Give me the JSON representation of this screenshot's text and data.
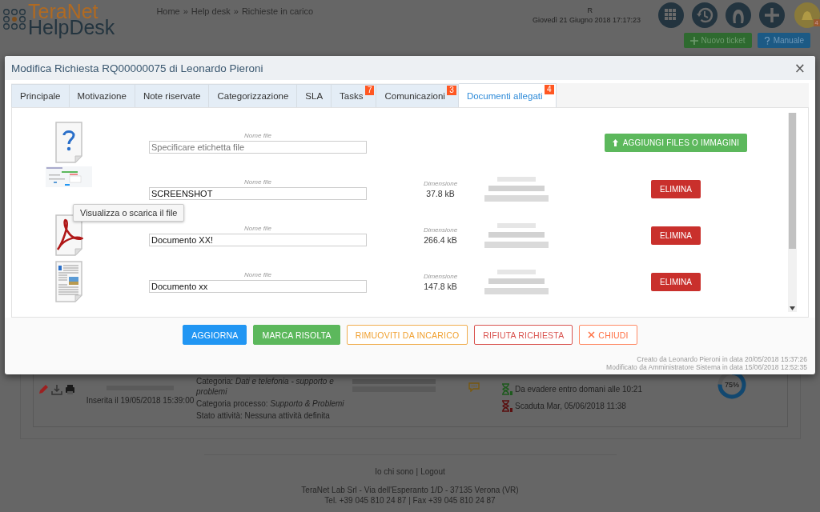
{
  "header": {
    "brand": "TeraNet",
    "product": "HelpDesk",
    "breadcrumb": [
      "Home",
      "Help desk",
      "Richieste in carico"
    ],
    "separator": "»",
    "user_initial": "R",
    "datetime": "Giovedì 21 Giugno 2018 17:17:23",
    "notification_count": "4",
    "buttons": [
      {
        "label": "Nuovo ticket",
        "kind": "new"
      },
      {
        "label": "Manuale",
        "kind": "help"
      }
    ]
  },
  "ticket_card": {
    "inserted": "Inserita il 19/05/2018 15:39:00",
    "details": [
      "Categoria: *Dati e telefonia - supporto e problemi*",
      "Categoria processo: *Supporto & Problemi*",
      "Stato attività:  Nessuna attività definita"
    ],
    "deadlines": [
      {
        "text": "Da evadere entro domani alle 10:21",
        "kind": "ok"
      },
      {
        "text": "Scaduta Mar, 05/06/2018 11:38",
        "kind": "late"
      }
    ],
    "progress": {
      "level": 0.75,
      "label": "75%"
    }
  },
  "footer": {
    "links": [
      "Io chi sono",
      "Logout"
    ],
    "separator": "|",
    "address": [
      "TeraNet Lab Srl - Via dell'Esperanto 1/D - 37135 Verona (VR)",
      "Tel. +39 045 810 24 87 | Fax +39 045 810 24 87"
    ]
  },
  "modal": {
    "title": "Modifica Richiesta RQ00000075 di Leonardo Pieroni",
    "close": "×",
    "tabs": [
      {
        "label": "Principale",
        "selected": false
      },
      {
        "label": "Motivazione",
        "selected": false
      },
      {
        "label": "Note riservate",
        "selected": false
      },
      {
        "label": "Categorizzazione",
        "selected": false
      },
      {
        "label": "SLA",
        "selected": false
      },
      {
        "label": "Tasks",
        "selected": false,
        "badge": "7"
      },
      {
        "label": "Comunicazioni",
        "selected": false,
        "badge": "3"
      },
      {
        "label": "Documenti allegati",
        "selected": true,
        "badge": "4"
      }
    ],
    "upload_button": "AGGIUNGI FILES O IMMAGINI",
    "files": [
      {
        "kind": "unknown",
        "name_label": "Nome file",
        "placeholder": "Specificare etichetta file"
      },
      {
        "kind": "image",
        "name_label": "Nome file",
        "value": "SCREENSHOT",
        "size_label": "Dimensione",
        "size": "37.8 kB",
        "delete": "ELIMINA"
      },
      {
        "kind": "pdf",
        "name_label": "Nome file",
        "value": "Documento XX!",
        "size_label": "Dimensione",
        "size": "266.4 kB",
        "delete": "ELIMINA"
      },
      {
        "kind": "document",
        "name_label": "Nome file",
        "value": "Documento xx",
        "size_label": "Dimensione",
        "size": "147.8 kB",
        "delete": "ELIMINA"
      }
    ],
    "tooltip": "Visualizza o scarica il file",
    "actions": [
      {
        "label": "AGGIORNA",
        "kind": "primary"
      },
      {
        "label": "MARCA RISOLTA",
        "kind": "success"
      },
      {
        "label": "RIMUOVITI DA INCARICO",
        "kind": "warning"
      },
      {
        "label": "RIFIUTA RICHIESTA",
        "kind": "danger"
      },
      {
        "label": "CHIUDI",
        "kind": "close"
      }
    ],
    "created": "Creato da Leonardo Pieroni in data 20/05/2018 15:37:26",
    "modified": "Modificato da Amministratore Sistema in data 15/06/2018 12:52:35"
  }
}
